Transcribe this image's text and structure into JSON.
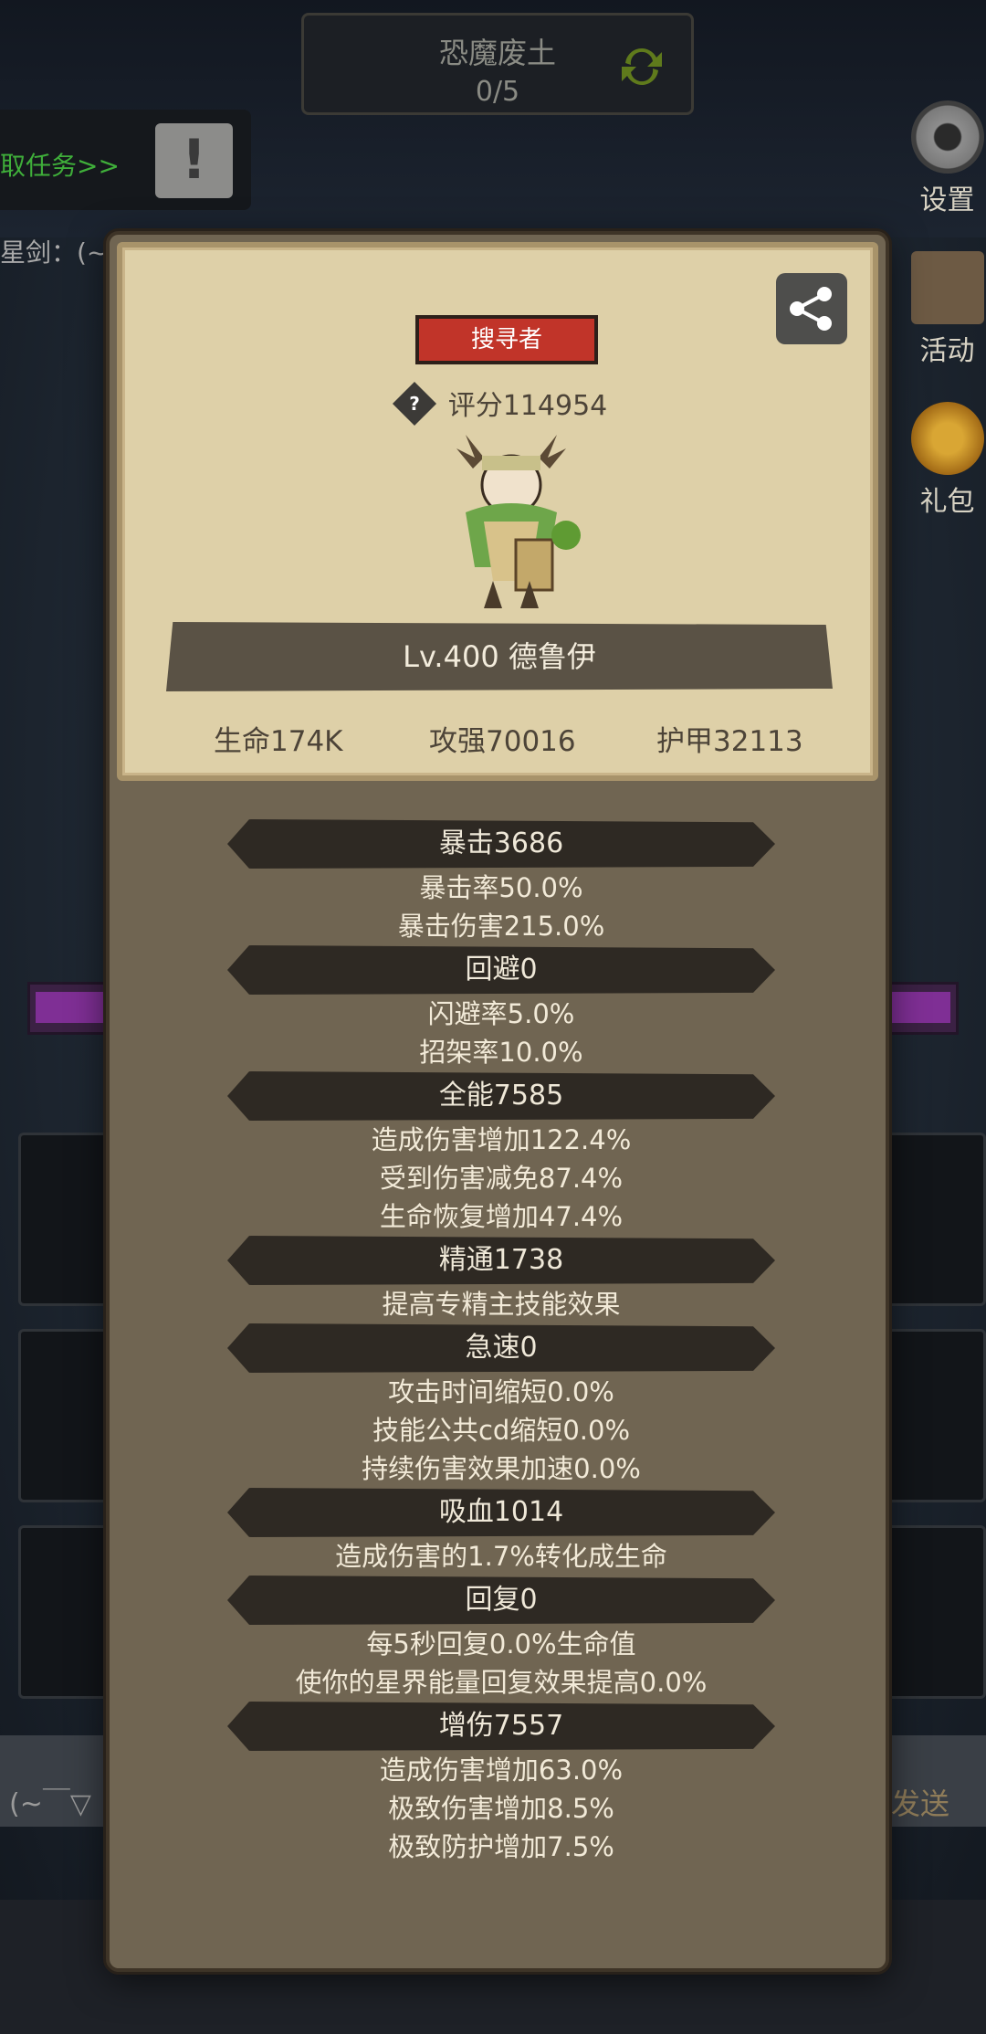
{
  "background": {
    "zone": {
      "title": "恐魔废土",
      "progress": "0/5"
    },
    "quest_text": "取任务>>",
    "left_label": "星剑：(~",
    "side_buttons": {
      "settings": "设置",
      "activity": "活动",
      "gift": "礼包"
    },
    "bottom_left_text": "(~￣▽",
    "bottom_send": "发送"
  },
  "card": {
    "role": "搜寻者",
    "score": "评分114954",
    "level_name": "Lv.400 德鲁伊",
    "stats": {
      "hp": "生命174K",
      "attack": "攻强70016",
      "armor": "护甲32113"
    }
  },
  "attributes": [
    {
      "header": "暴击3686",
      "lines": [
        "暴击率50.0%",
        "暴击伤害215.0%"
      ]
    },
    {
      "header": "回避0",
      "lines": [
        "闪避率5.0%",
        "招架率10.0%"
      ]
    },
    {
      "header": "全能7585",
      "lines": [
        "造成伤害增加122.4%",
        "受到伤害减免87.4%",
        "生命恢复增加47.4%"
      ]
    },
    {
      "header": "精通1738",
      "lines": [
        "提高专精主技能效果"
      ]
    },
    {
      "header": "急速0",
      "lines": [
        "攻击时间缩短0.0%",
        "技能公共cd缩短0.0%",
        "持续伤害效果加速0.0%"
      ]
    },
    {
      "header": "吸血1014",
      "lines": [
        "造成伤害的1.7%转化成生命"
      ]
    },
    {
      "header": "回复0",
      "lines": [
        "每5秒回复0.0%生命值",
        "使你的星界能量回复效果提高0.0%"
      ]
    },
    {
      "header": "增伤7557",
      "lines": [
        "造成伤害增加63.0%",
        "极致伤害增加8.5%",
        "极致防护增加7.5%"
      ]
    }
  ]
}
